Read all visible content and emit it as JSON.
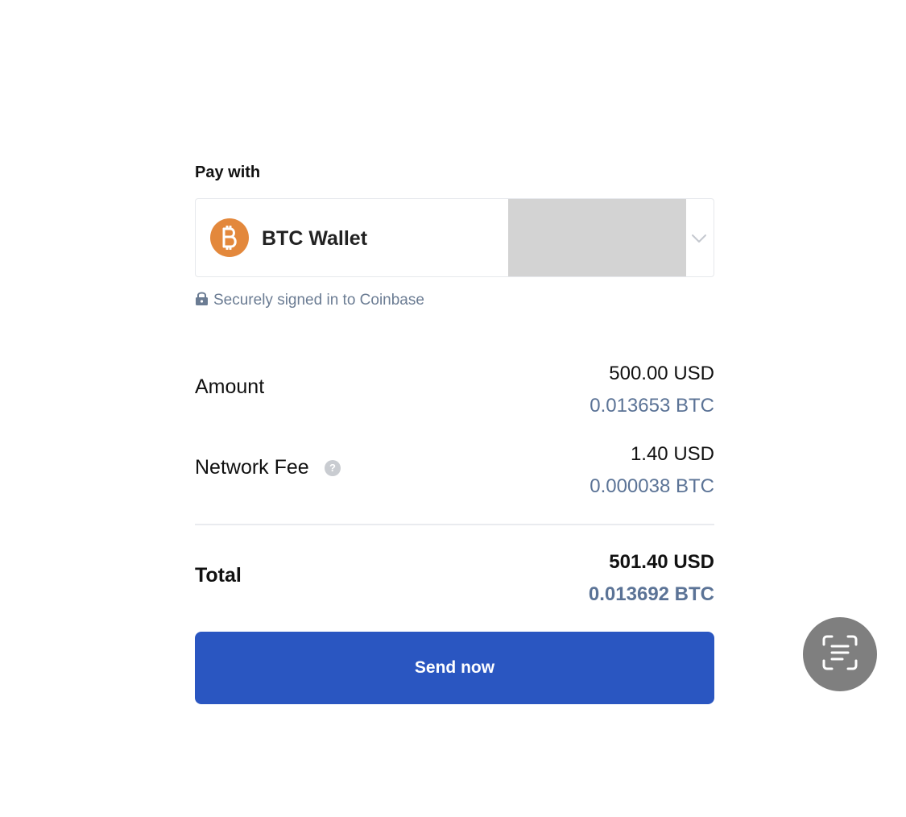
{
  "pay_with": {
    "label": "Pay with",
    "wallet": {
      "name": "BTC Wallet",
      "icon": "bitcoin-icon",
      "icon_color": "#e3883c"
    },
    "dropdown_icon": "chevron-down-icon"
  },
  "secure_notice": {
    "icon": "lock-icon",
    "text": "Securely signed in to Coinbase"
  },
  "summary": {
    "amount": {
      "label": "Amount",
      "usd": "500.00 USD",
      "btc": "0.013653 BTC"
    },
    "network_fee": {
      "label": "Network Fee",
      "help_icon": "help-icon",
      "usd": "1.40 USD",
      "btc": "0.000038 BTC"
    },
    "total": {
      "label": "Total",
      "usd": "501.40 USD",
      "btc": "0.013692 BTC"
    }
  },
  "actions": {
    "send_label": "Send now",
    "send_color": "#2a56c1"
  },
  "overlay": {
    "scan_icon": "text-scan-icon"
  },
  "colors": {
    "secondary_text": "#6b7c93",
    "btc_text": "#5b7396"
  }
}
